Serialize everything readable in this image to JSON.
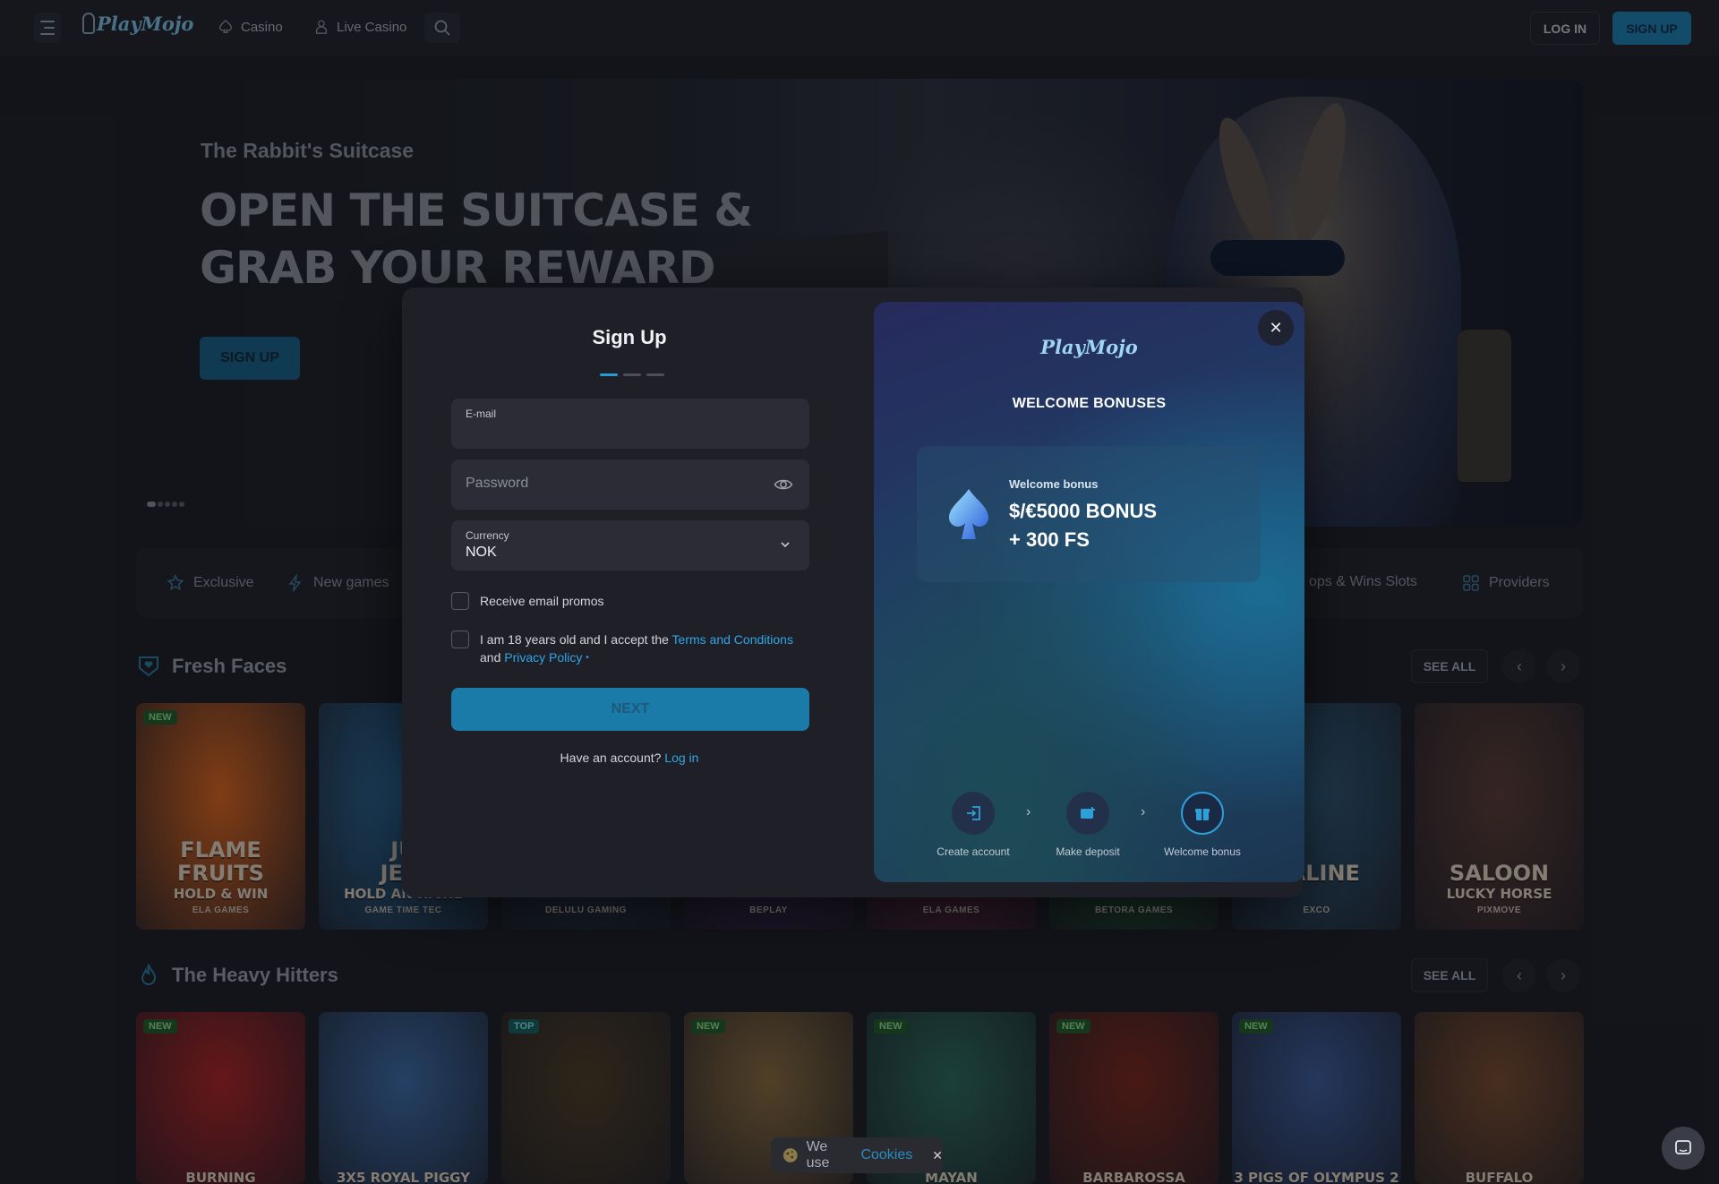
{
  "nav": {
    "logo": "PlayMojo",
    "casino": "Casino",
    "live_casino": "Live Casino",
    "login": "LOG IN",
    "signup": "SIGN UP"
  },
  "hero": {
    "kicker": "The Rabbit's Suitcase",
    "title_line1": "OPEN THE SUITCASE &",
    "title_line2": "GRAB YOUR REWARD",
    "button": "SIGN UP"
  },
  "categories": {
    "exclusive": "Exclusive",
    "new_games": "New games",
    "drops_wins": "ops & Wins Slots",
    "providers": "Providers"
  },
  "sections": {
    "fresh_faces": "Fresh Faces",
    "heavy_hitters": "The Heavy Hitters",
    "see_all": "SEE ALL"
  },
  "fresh_cards": [
    {
      "badge": "NEW",
      "title1": "FLAME",
      "title2": "FRUITS",
      "sub": "HOLD & WIN",
      "provider": "ELA GAMES",
      "bg": "#e0641a"
    },
    {
      "badge": "",
      "title1": "JU",
      "title2": "JEW",
      "sub": "HOLD AN RICHE",
      "provider": "GAME TIME TEC",
      "bg": "#2a6fa4"
    },
    {
      "badge": "",
      "title1": "",
      "title2": "",
      "sub": "",
      "provider": "DELULU GAMING",
      "bg": "#22344a"
    },
    {
      "badge": "",
      "title1": "",
      "title2": "",
      "sub": "",
      "provider": "BEPLAY",
      "bg": "#3b1e52"
    },
    {
      "badge": "",
      "title1": "",
      "title2": "",
      "sub": "",
      "provider": "ELA GAMES",
      "bg": "#6b2040"
    },
    {
      "badge": "",
      "title1": "",
      "title2": "",
      "sub": "",
      "provider": "BETORA GAMES",
      "bg": "#1e5a30"
    },
    {
      "badge": "",
      "title1": "",
      "title2": "CALINE",
      "sub": "",
      "provider": "EXCO",
      "bg": "#2d5a7a"
    },
    {
      "badge": "",
      "title1": "",
      "title2": "SALOON",
      "sub": "LUCKY HORSE",
      "provider": "PIXMOVE",
      "bg": "#5a3a30"
    }
  ],
  "heavy_cards": [
    {
      "badge": "NEW",
      "title": "BURNING",
      "bg": "#b02020"
    },
    {
      "badge": "",
      "title": "3X5 ROYAL PIGGY",
      "bg": "#3b6ba8"
    },
    {
      "badge": "TOP",
      "title": "",
      "bg": "#4a3a20"
    },
    {
      "badge": "NEW",
      "title": "",
      "bg": "#8a6a3a"
    },
    {
      "badge": "NEW",
      "title": "MAYAN",
      "bg": "#2a6a5a"
    },
    {
      "badge": "NEW",
      "title": "BARBAROSSA",
      "bg": "#7a2418"
    },
    {
      "badge": "NEW",
      "title": "3 PIGS OF OLYMPUS 2",
      "bg": "#3a5a9a"
    },
    {
      "badge": "",
      "title": "BUFFALO",
      "bg": "#7a4a2a"
    }
  ],
  "modal": {
    "title": "Sign Up",
    "email_label": "E-mail",
    "password_placeholder": "Password",
    "currency_label": "Currency",
    "currency_value": "NOK",
    "promos": "Receive email promos",
    "terms_prefix": "I am 18 years old and I accept the",
    "terms_link": "Terms and Conditions",
    "terms_and": "and",
    "privacy_link": "Privacy Policy",
    "next": "NEXT",
    "have_account": "Have an account?",
    "login_link": "Log in"
  },
  "bonus": {
    "logo": "PlayMojo",
    "title": "WELCOME BONUSES",
    "card_label": "Welcome bonus",
    "card_value_1": "$/€5000 BONUS",
    "card_value_2": "+ 300 FS",
    "step1": "Create account",
    "step2": "Make deposit",
    "step3": "Welcome bonus"
  },
  "cookie": {
    "text": "We use",
    "link": "Cookies"
  },
  "colors": {
    "accent": "#2ea6e6",
    "button_blue": "#1a7fb4",
    "background": "#1a1b21"
  }
}
